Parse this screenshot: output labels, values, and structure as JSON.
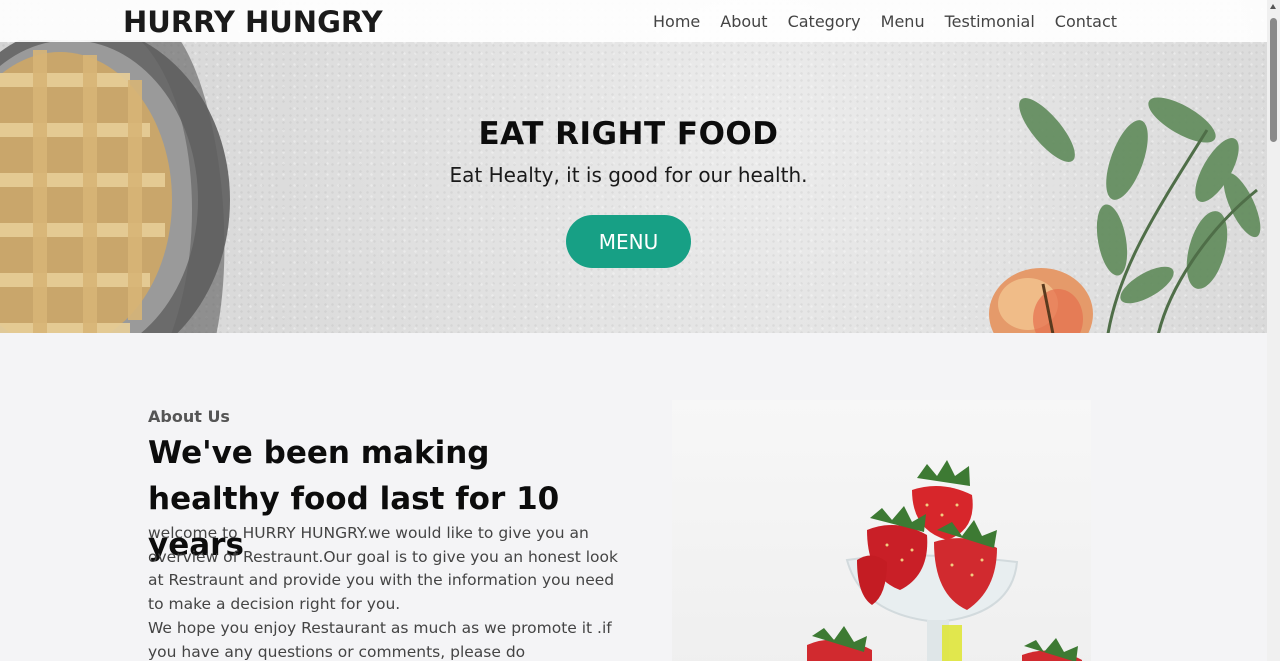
{
  "brand": "HURRY HUNGRY",
  "nav": [
    "Home",
    "About",
    "Category",
    "Menu",
    "Testimonial",
    "Contact"
  ],
  "hero": {
    "title": "EAT RIGHT FOOD",
    "subtitle": "Eat Healty, it is good for our health.",
    "button": "MENU"
  },
  "about": {
    "label": "About Us",
    "title": "We've been making healthy food last for 10 years",
    "paragraphs": [
      "welcome to HURRY HUNGRY.we would like to give you an overview of Restraunt.Our goal is to give you an honest look at Restraunt and provide you with the information you need to make a decision right for you.",
      "We hope you enjoy Restaurant as much as we promote it .if you have any questions or comments, please do"
    ]
  },
  "colors": {
    "accent": "#17a085",
    "background": "#f4f4f6",
    "heading": "#0c0c0c"
  },
  "images": {
    "hero_left": "lattice-pie-image",
    "hero_right": "leafy-branch-image",
    "hero_apple": "apple-image",
    "about": "strawberries-in-glass-image"
  }
}
